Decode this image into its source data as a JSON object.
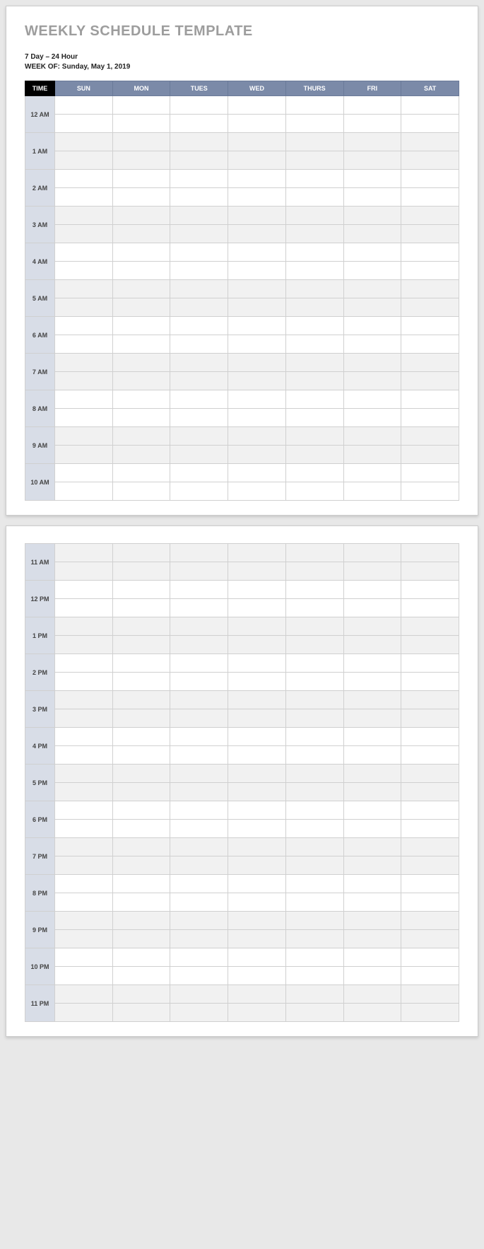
{
  "title": "WEEKLY SCHEDULE TEMPLATE",
  "subtitle1": "7 Day – 24 Hour",
  "subtitle2": "WEEK OF: Sunday, May 1, 2019",
  "header": {
    "time": "TIME",
    "days": [
      "SUN",
      "MON",
      "TUES",
      "WED",
      "THURS",
      "FRI",
      "SAT"
    ]
  },
  "hours_page1": [
    "12 AM",
    "1 AM",
    "2 AM",
    "3 AM",
    "4 AM",
    "5 AM",
    "6 AM",
    "7 AM",
    "8 AM",
    "9 AM",
    "10 AM"
  ],
  "hours_page2": [
    "11 AM",
    "12 PM",
    "1 PM",
    "2 PM",
    "3 PM",
    "4 PM",
    "5 PM",
    "6 PM",
    "7 PM",
    "8 PM",
    "9 PM",
    "10 PM",
    "11 PM"
  ]
}
